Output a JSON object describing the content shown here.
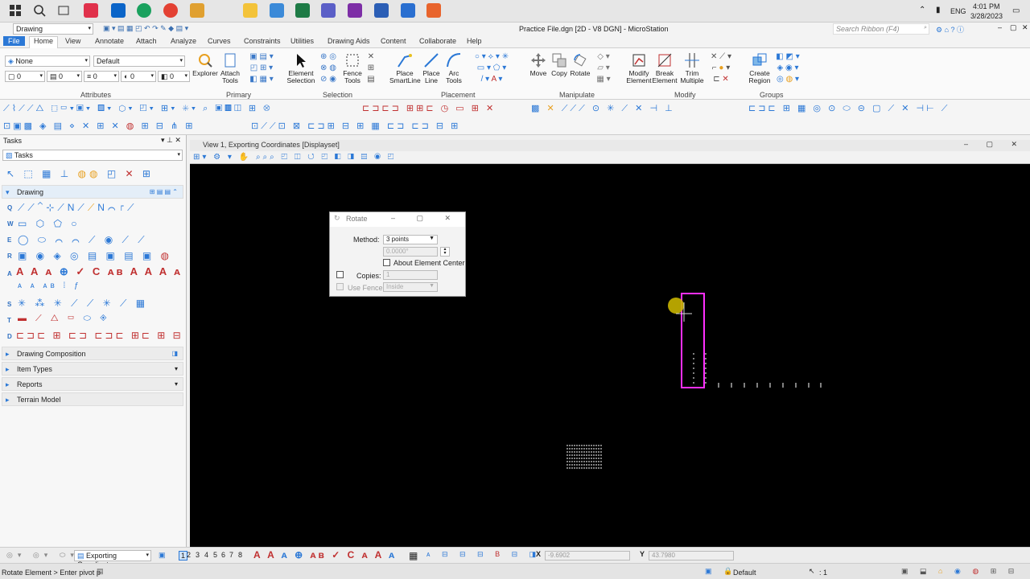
{
  "taskbar": {
    "time": "4:01 PM",
    "date": "3/28/2023",
    "language": "ENG"
  },
  "quick_access": {
    "workflow": "Drawing"
  },
  "title": {
    "text": "Practice File.dgn [2D - V8 DGN] - MicroStation",
    "search_placeholder": "Search Ribbon (F4)"
  },
  "ribbon_tabs": [
    "File",
    "Home",
    "View",
    "Annotate",
    "Attach",
    "Analyze",
    "Curves",
    "Constraints",
    "Utilities",
    "Drawing Aids",
    "Content",
    "Collaborate",
    "Help"
  ],
  "ribbon": {
    "attributes": {
      "label": "Attributes",
      "level": "None",
      "style": "Default",
      "color": "0",
      "weight": "0",
      "linestyle": "0",
      "transparency": "0",
      "priority": "0"
    },
    "primary": {
      "label": "Primary",
      "explorer": "Explorer",
      "attach_tools": "Attach Tools"
    },
    "selection": {
      "label": "Selection",
      "element_selection": "Element Selection",
      "fence_tools": "Fence Tools"
    },
    "placement": {
      "label": "Placement",
      "smartline": "Place SmartLine",
      "line": "Place Line",
      "arc": "Arc Tools"
    },
    "manipulate": {
      "label": "Manipulate",
      "move": "Move",
      "copy": "Copy",
      "rotate": "Rotate"
    },
    "modify": {
      "label": "Modify",
      "modify_element": "Modify Element",
      "break_element": "Break Element",
      "trim_multiple": "Trim Multiple"
    },
    "groups": {
      "label": "Groups",
      "create_region": "Create Region"
    }
  },
  "tasks_panel": {
    "title": "Tasks",
    "dropdown": "Tasks",
    "drawing_section": "Drawing",
    "row_letters": [
      "Q",
      "W",
      "E",
      "R",
      "A",
      "S",
      "T",
      "D"
    ],
    "collapsed_sections": [
      "Drawing Composition",
      "Item Types",
      "Reports",
      "Terrain Model"
    ]
  },
  "view": {
    "title": "View 1, Exporting Coordinates [Displayset]"
  },
  "rotate_dialog": {
    "title": "Rotate",
    "method_label": "Method:",
    "method_value": "3 points",
    "angle_value": "0.0000°",
    "about_center": "About Element Center",
    "copies_label": "Copies:",
    "copies_value": "1",
    "use_fence_label": "Use Fence:",
    "use_fence_value": "Inside"
  },
  "bottom_bar": {
    "view_group": "Exporting Coordinat",
    "view_numbers": [
      "1",
      "2",
      "3",
      "4",
      "5",
      "6",
      "7",
      "8"
    ],
    "x_label": "X",
    "x_value": "-9.6902",
    "y_label": "Y",
    "y_value": "43.7980"
  },
  "status": {
    "prompt": "Rotate Element > Enter pivot p",
    "level": "Default",
    "selection_count": ": 1"
  },
  "colors": {
    "accent": "#2b78d6",
    "element_highlight": "#ff2fff",
    "cursor_marker": "#c8b400",
    "view_background": "#000000"
  }
}
